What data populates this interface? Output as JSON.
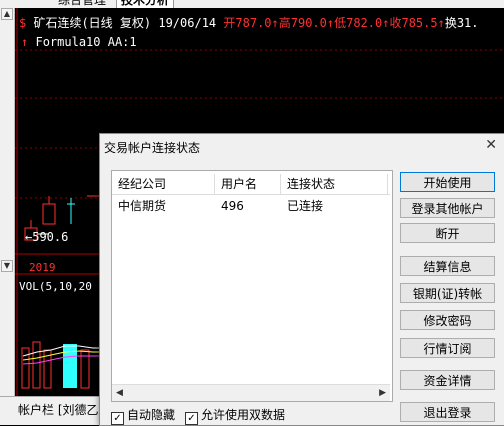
{
  "tabs": {
    "tab1": "综合管理",
    "tab2": "技术分析"
  },
  "chart": {
    "header_prefix": "$ ",
    "title": "矿石连续(日线 复权) 19/06/14",
    "open": "开787.0↑",
    "high": "高790.0↑",
    "low": "低782.0↑",
    "close": "收785.5↑",
    "extra": "换31.",
    "formula": "Formula10 AA:1",
    "price_label": "590.6",
    "year": "2019",
    "vol": "VOL(5,10,20"
  },
  "statusbar": {
    "text": "帐户栏 [刘德乙"
  },
  "dialog": {
    "title": "交易帐户连接状态",
    "close": "✕",
    "columns": [
      "经纪公司",
      "用户名",
      "连接状态"
    ],
    "rows": [
      {
        "broker": "中信期货",
        "user": "496",
        "status": "已连接"
      }
    ],
    "buttons": {
      "start": "开始使用",
      "login_other": "登录其他帐户",
      "disconnect": "断开",
      "settlement": "结算信息",
      "bank_transfer": "银期(证)转帐",
      "change_password": "修改密码",
      "quotes": "行情订阅",
      "funds": "资金详情",
      "logout": "退出登录"
    },
    "checkboxes": {
      "auto_hide": "自动隐藏",
      "dual_data": "允许使用双数据"
    }
  },
  "colors": {
    "chart_bg": "#000000",
    "up": "#ff3030",
    "dialog_bg": "#f0f0f0"
  }
}
